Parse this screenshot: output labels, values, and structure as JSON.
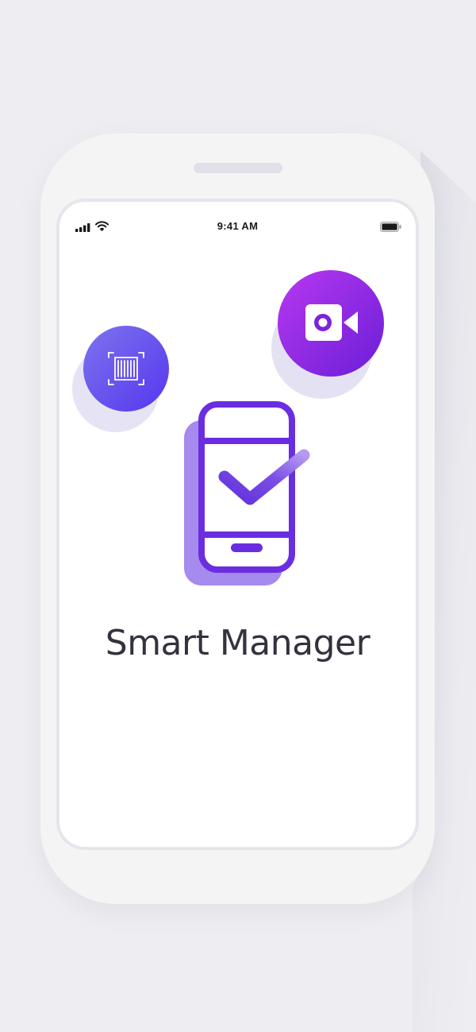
{
  "status_bar": {
    "time": "9:41 AM"
  },
  "app": {
    "name": "Smart Manager"
  },
  "icons": [
    "cellular-signal-icon",
    "wifi-icon",
    "battery-icon",
    "barcode-scan-icon",
    "video-camera-icon",
    "phone-check-icon"
  ],
  "colors": {
    "background": "#eeeef2",
    "phone_body": "#f4f4f4",
    "accent_purple": "#6a2ee0",
    "accent_light": "#a98af0",
    "video_gradient_start": "#b534f0",
    "video_gradient_end": "#6c1ed8",
    "barcode_gradient_start": "#7a70ee",
    "barcode_gradient_end": "#5a3ff0",
    "text_dark": "#33323e"
  }
}
